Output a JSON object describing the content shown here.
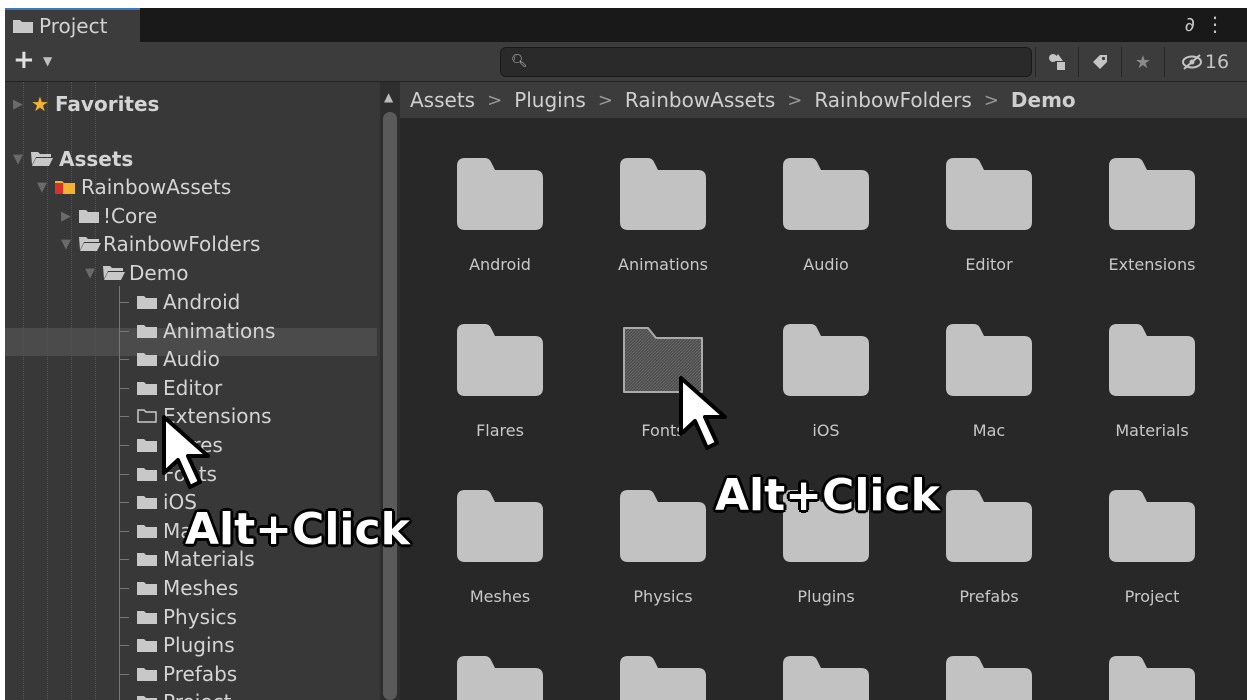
{
  "tab": {
    "title": "Project"
  },
  "toolbar": {
    "create_label": "+",
    "search_placeholder": "",
    "hidden_count": "16",
    "buttons": [
      "filter-by-type-icon",
      "filter-by-label-icon",
      "favorites-star-icon",
      "hidden-packages-icon"
    ]
  },
  "sidebar": {
    "favorites_label": "Favorites",
    "assets_label": "Assets",
    "rainbow_assets_label": "RainbowAssets",
    "core_label": "!Core",
    "rainbow_folders_label": "RainbowFolders",
    "demo_label": "Demo",
    "children": [
      "Android",
      "Animations",
      "Audio",
      "Editor",
      "Extensions",
      "Flares",
      "Fonts",
      "iOS",
      "Mac",
      "Materials",
      "Meshes",
      "Physics",
      "Plugins",
      "Prefabs",
      "Project"
    ]
  },
  "breadcrumb": [
    "Assets",
    "Plugins",
    "RainbowAssets",
    "RainbowFolders",
    "Demo"
  ],
  "grid": {
    "items": [
      "Android",
      "Animations",
      "Audio",
      "Editor",
      "Extensions",
      "Flares",
      "Fonts",
      "iOS",
      "Mac",
      "Materials",
      "Meshes",
      "Physics",
      "Plugins",
      "Prefabs",
      "Project"
    ]
  },
  "annotations": {
    "left": "Alt+Click",
    "right": "Alt+Click"
  },
  "colors": {
    "panel_bg": "#282828",
    "sidebar_bg": "#383838",
    "folder_fill": "#c2c2c2",
    "accent": "#3a79bb",
    "favorites_star": "#f2b430",
    "rainbow_folder_red": "#d9312b",
    "rainbow_folder_yellow": "#f2b430"
  }
}
